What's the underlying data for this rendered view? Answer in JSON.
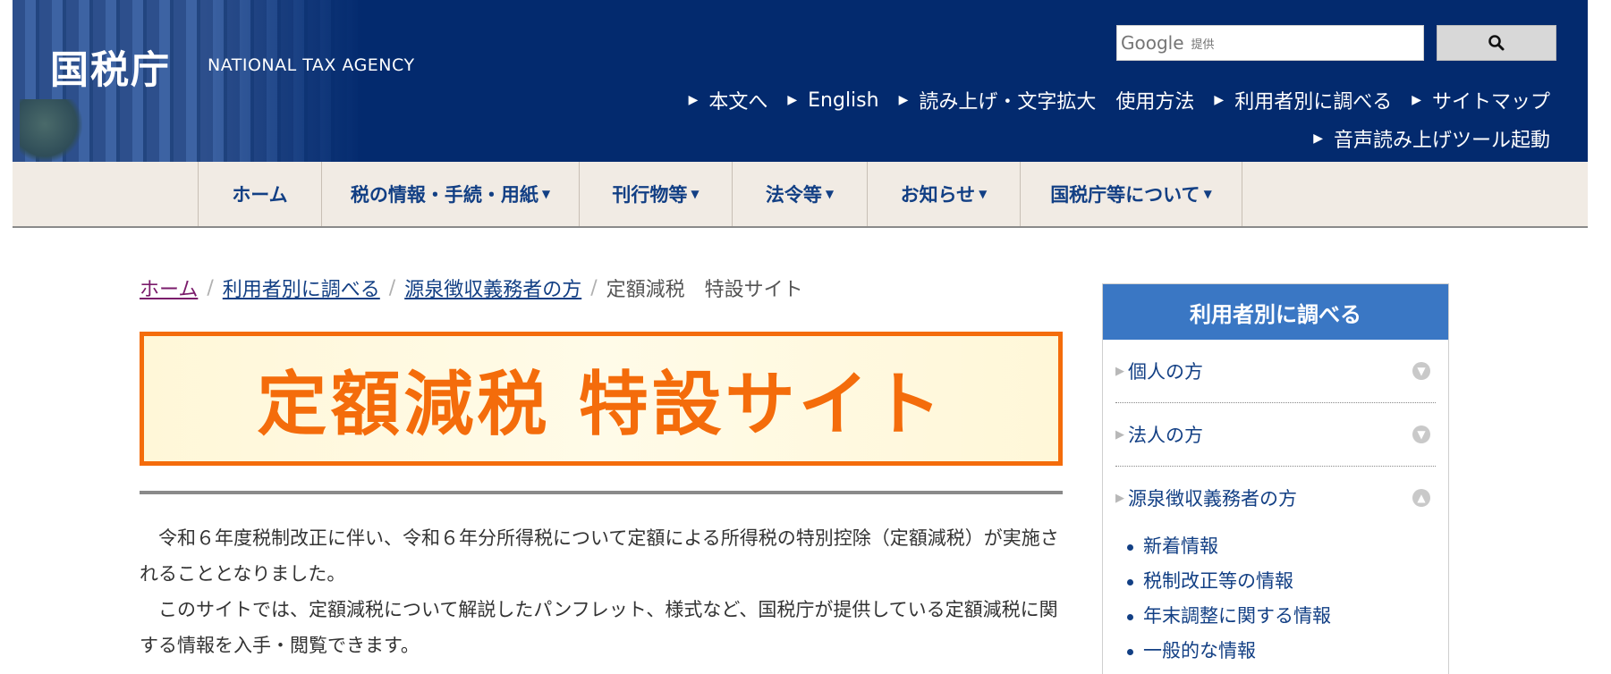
{
  "header": {
    "logo_ja": "国税庁",
    "logo_en": "NATIONAL TAX AGENCY",
    "search": {
      "brand": "Google",
      "provided_by": "提供",
      "button_icon": "search-icon"
    },
    "util_links_row1": [
      {
        "label": "本文へ",
        "arrow": true
      },
      {
        "label": "English",
        "arrow": true
      },
      {
        "label": "読み上げ・文字拡大",
        "arrow": true
      },
      {
        "label": "使用方法",
        "arrow": false
      },
      {
        "label": "利用者別に調べる",
        "arrow": true
      },
      {
        "label": "サイトマップ",
        "arrow": true
      }
    ],
    "util_links_row2": [
      {
        "label": "音声読み上げツール起動",
        "arrow": true
      }
    ]
  },
  "nav": {
    "items": [
      {
        "label": "ホーム",
        "dropdown": false
      },
      {
        "label": "税の情報・手続・用紙",
        "dropdown": true
      },
      {
        "label": "刊行物等",
        "dropdown": true
      },
      {
        "label": "法令等",
        "dropdown": true
      },
      {
        "label": "お知らせ",
        "dropdown": true
      },
      {
        "label": "国税庁等について",
        "dropdown": true
      }
    ]
  },
  "breadcrumb": {
    "links": [
      "ホーム",
      "利用者別に調べる",
      "源泉徴収義務者の方"
    ],
    "current": "定額減税　特設サイト"
  },
  "banner": {
    "title": "定額減税 特設サイト"
  },
  "intro": {
    "paragraphs": [
      "令和６年度税制改正に伴い、令和６年分所得税について定額による所得税の特別控除（定額減税）が実施されることとなりました。",
      "このサイトでは、定額減税について解説したパンフレット、様式など、国税庁が提供している定額減税に関する情報を入手・閲覧できます。"
    ]
  },
  "sidebar": {
    "title": "利用者別に調べる",
    "sections": [
      {
        "label": "個人の方",
        "expanded": false
      },
      {
        "label": "法人の方",
        "expanded": false
      },
      {
        "label": "源泉徴収義務者の方",
        "expanded": true
      }
    ],
    "sub_items": [
      "新着情報",
      "税制改正等の情報",
      "年末調整に関する情報",
      "一般的な情報"
    ]
  },
  "colors": {
    "header_bg": "#032a6e",
    "nav_bg": "#f1ebe4",
    "nav_text": "#123f84",
    "banner_accent": "#f46c0b",
    "sidebar_head": "#3a77c4"
  }
}
